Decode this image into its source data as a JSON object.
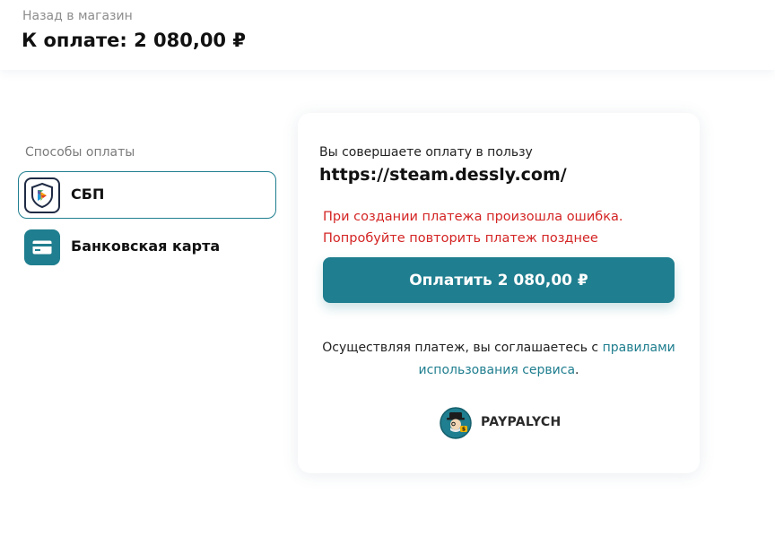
{
  "header": {
    "back_link": "Назад в магазин",
    "amount_title": "К оплате: 2 080,00 ₽"
  },
  "sidebar": {
    "heading": "Способы оплаты",
    "methods": [
      {
        "label": "СБП",
        "icon": "sbp-icon",
        "selected": true
      },
      {
        "label": "Банковская карта",
        "icon": "bank-card-icon",
        "selected": false
      }
    ]
  },
  "panel": {
    "recipient_label": "Вы совершаете оплату в пользу",
    "recipient_url": "https://steam.dessly.com/",
    "error_lines": [
      "При создании платежа произошла ошибка.",
      "Попробуйте повторить платеж позднее"
    ],
    "pay_button": "Оплатить 2 080,00 ₽",
    "terms_prefix": "Осуществляя платеж, вы соглашаетесь с ",
    "terms_link": "правилами использования сервиса",
    "terms_suffix": ".",
    "provider_name": "PAYPALYCH"
  },
  "colors": {
    "accent": "#1f7e8f",
    "error": "#d42525",
    "muted_text": "#8d8d8d"
  }
}
